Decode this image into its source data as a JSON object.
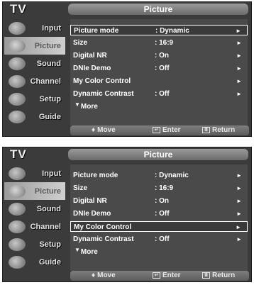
{
  "screens": [
    {
      "tv_label": "TV",
      "panel_title": "Picture",
      "sidebar": [
        {
          "label": "Input",
          "icon": "input-icon"
        },
        {
          "label": "Picture",
          "icon": "picture-icon"
        },
        {
          "label": "Sound",
          "icon": "sound-icon"
        },
        {
          "label": "Channel",
          "icon": "channel-icon"
        },
        {
          "label": "Setup",
          "icon": "setup-icon"
        },
        {
          "label": "Guide",
          "icon": "guide-icon"
        }
      ],
      "rows": [
        {
          "label": "Picture mode",
          "value": ": Dynamic",
          "arrow": "►"
        },
        {
          "label": "Size",
          "value": ": 16:9",
          "arrow": "►"
        },
        {
          "label": "Digital NR",
          "value": ": On",
          "arrow": "►"
        },
        {
          "label": "DNIe Demo",
          "value": ": Off",
          "arrow": "►"
        },
        {
          "label": "My Color Control",
          "value": "",
          "arrow": "►"
        },
        {
          "label": "Dynamic Contrast",
          "value": ": Off",
          "arrow": "►"
        }
      ],
      "more_label": "More",
      "footer": {
        "move": "Move",
        "enter": "Enter",
        "return": "Return"
      }
    },
    {
      "tv_label": "TV",
      "panel_title": "Picture",
      "sidebar": [
        {
          "label": "Input",
          "icon": "input-icon"
        },
        {
          "label": "Picture",
          "icon": "picture-icon"
        },
        {
          "label": "Sound",
          "icon": "sound-icon"
        },
        {
          "label": "Channel",
          "icon": "channel-icon"
        },
        {
          "label": "Setup",
          "icon": "setup-icon"
        },
        {
          "label": "Guide",
          "icon": "guide-icon"
        }
      ],
      "rows": [
        {
          "label": "Picture mode",
          "value": ": Dynamic",
          "arrow": "►"
        },
        {
          "label": "Size",
          "value": ": 16:9",
          "arrow": "►"
        },
        {
          "label": "Digital NR",
          "value": ": On",
          "arrow": "►"
        },
        {
          "label": "DNIe Demo",
          "value": ": Off",
          "arrow": "►"
        },
        {
          "label": "My Color Control",
          "value": "",
          "arrow": "►"
        },
        {
          "label": "Dynamic Contrast",
          "value": ": Off",
          "arrow": "►"
        }
      ],
      "more_label": "More",
      "footer": {
        "move": "Move",
        "enter": "Enter",
        "return": "Return"
      }
    }
  ]
}
